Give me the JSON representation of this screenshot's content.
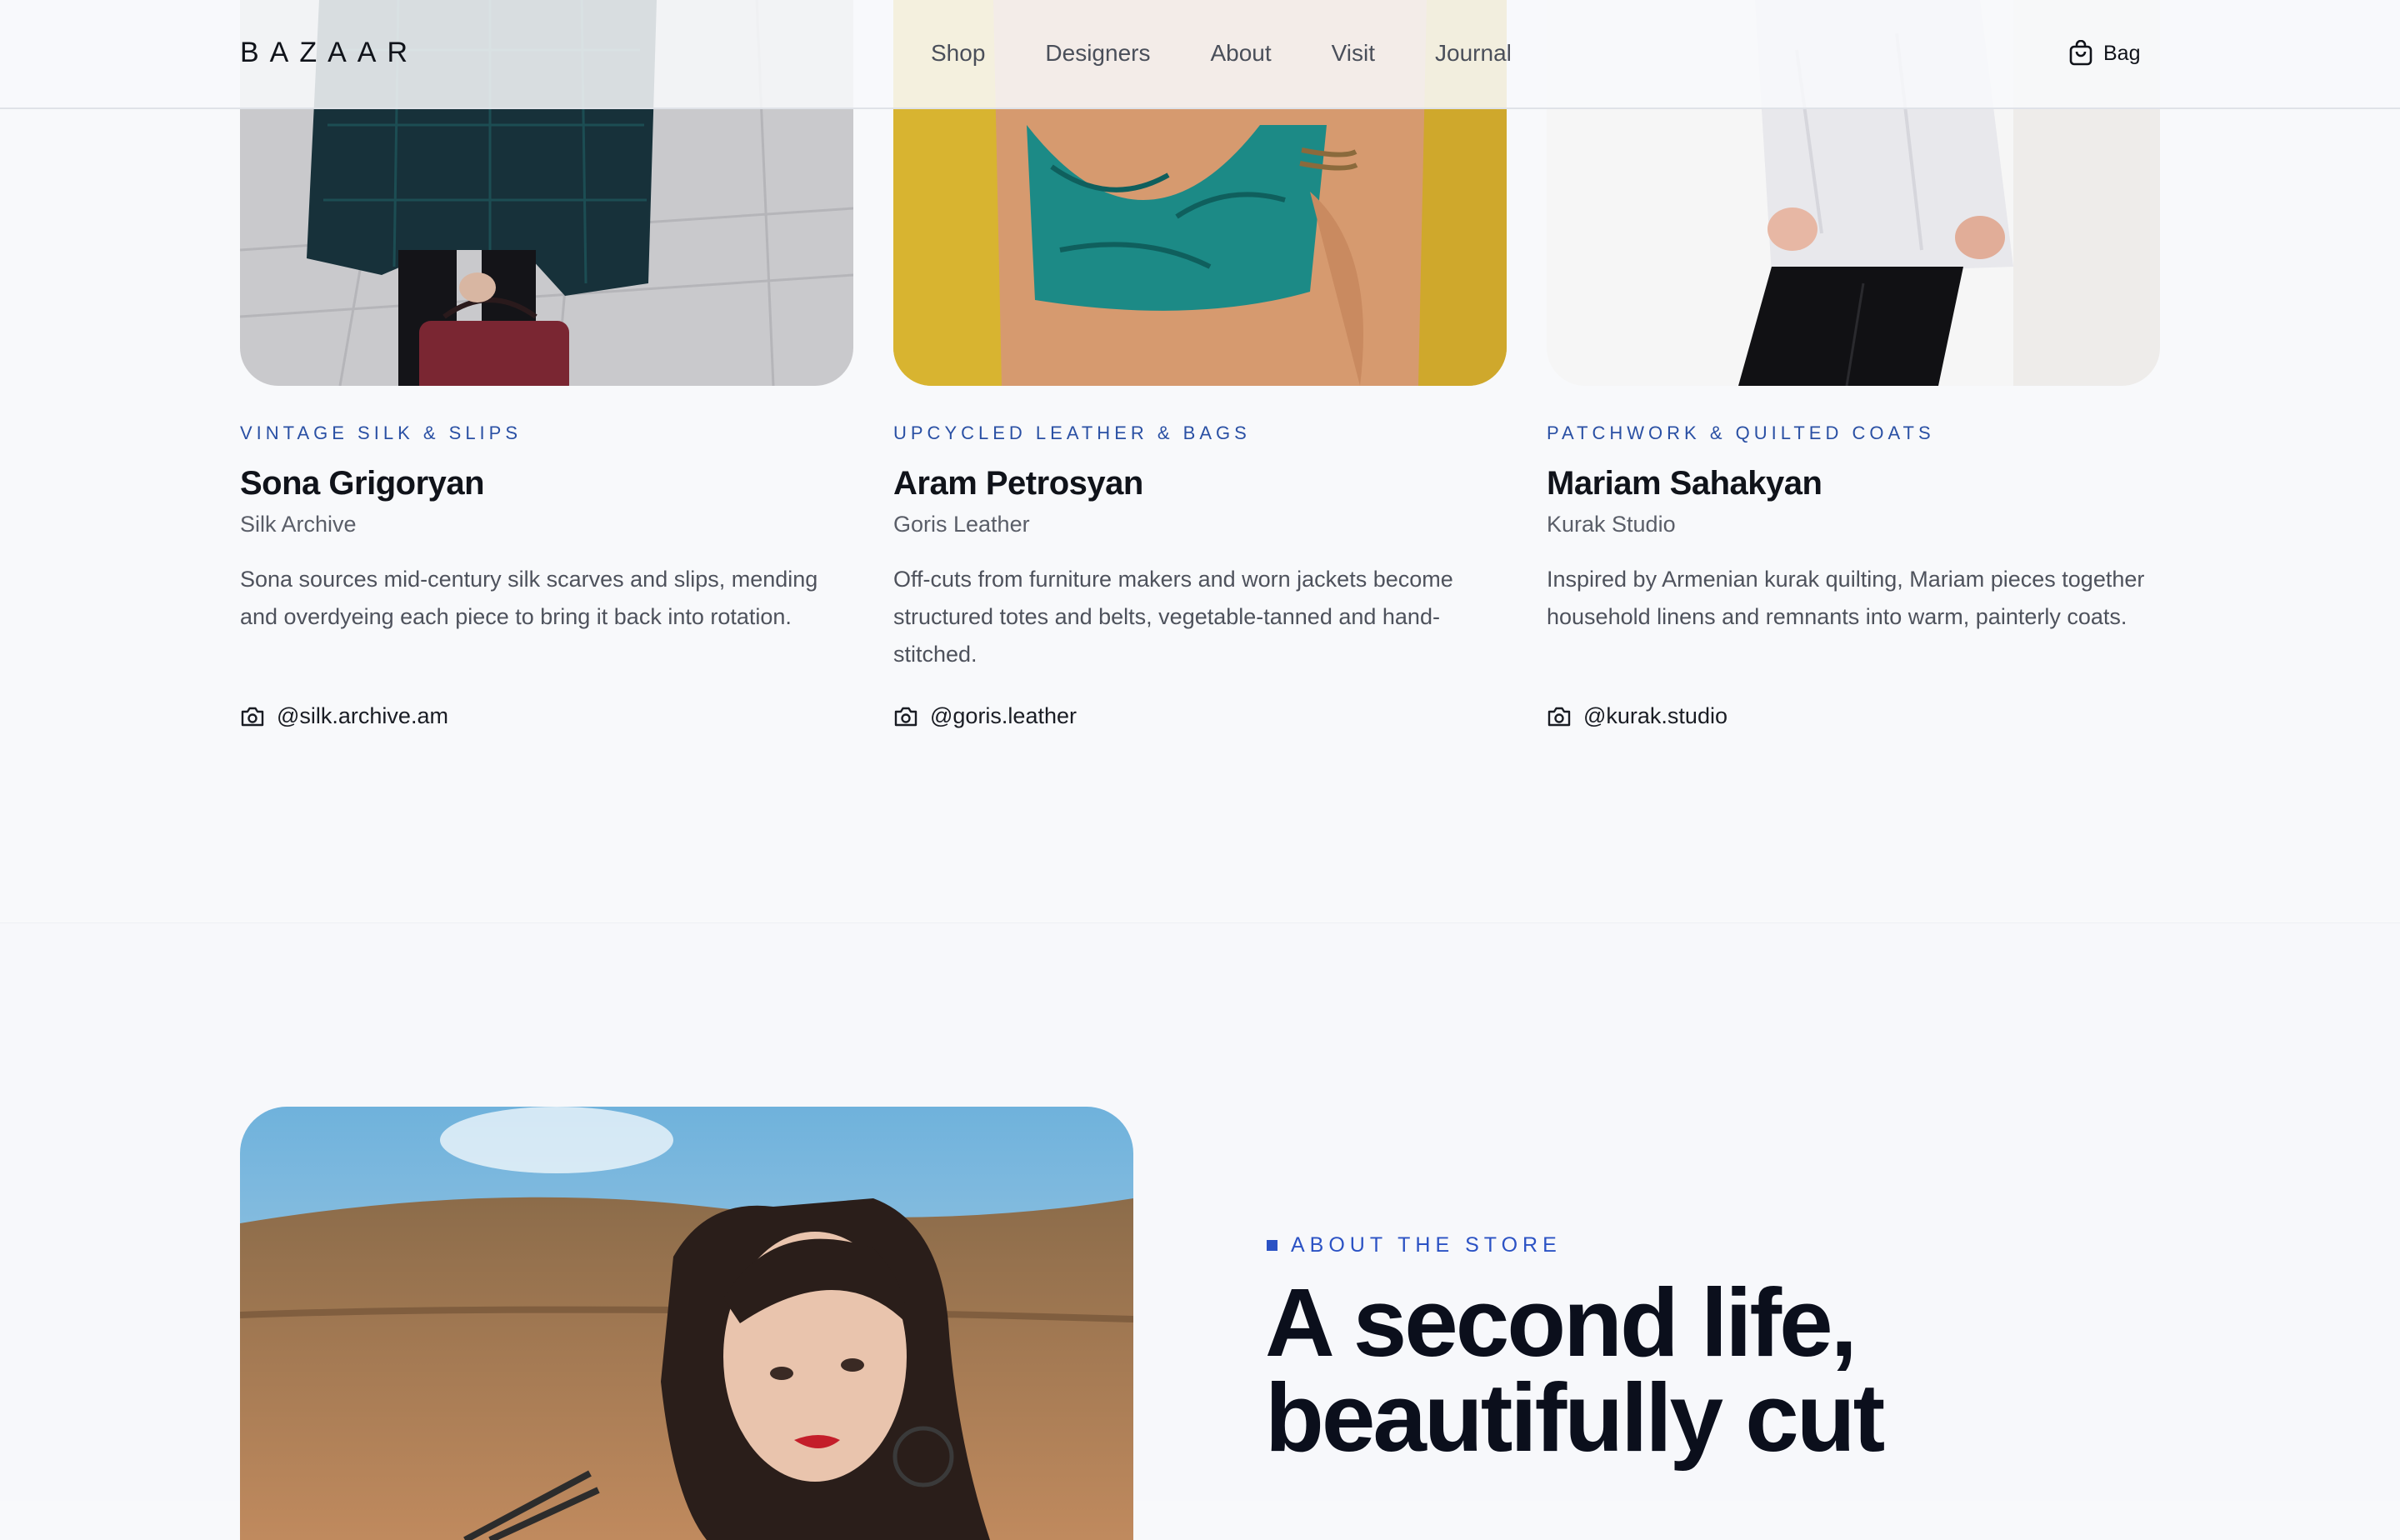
{
  "header": {
    "logo": "BAZAAR",
    "nav": [
      "Shop",
      "Designers",
      "About",
      "Visit",
      "Journal"
    ],
    "bag_label": "Bag"
  },
  "designers": [
    {
      "category": "VINTAGE SILK & SLIPS",
      "name": "Sona Grigoryan",
      "studio": "Silk Archive",
      "description": "Sona sources mid-century silk scarves and slips, mending and overdyeing each piece to bring it back into rotation.",
      "handle": "@silk.archive.am"
    },
    {
      "category": "UPCYCLED LEATHER & BAGS",
      "name": "Aram Petrosyan",
      "studio": "Goris Leather",
      "description": "Off-cuts from furniture makers and worn jackets become structured totes and belts, vegetable-tanned and hand-stitched.",
      "handle": "@goris.leather"
    },
    {
      "category": "PATCHWORK & QUILTED COATS",
      "name": "Mariam Sahakyan",
      "studio": "Kurak Studio",
      "description": "Inspired by Armenian kurak quilting, Mariam pieces together household linens and remnants into warm, painterly coats.",
      "handle": "@kurak.studio"
    }
  ],
  "about": {
    "eyebrow": "ABOUT THE STORE",
    "headline_line1": "A second life,",
    "headline_line2": "beautifully cut"
  },
  "colors": {
    "accent": "#2b52c4",
    "category_text": "#2a50a4",
    "background": "#f8f9fb",
    "heading": "#0b0f1c"
  },
  "icons": {
    "bag": "shopping-bag-icon",
    "handle": "camera-icon"
  }
}
